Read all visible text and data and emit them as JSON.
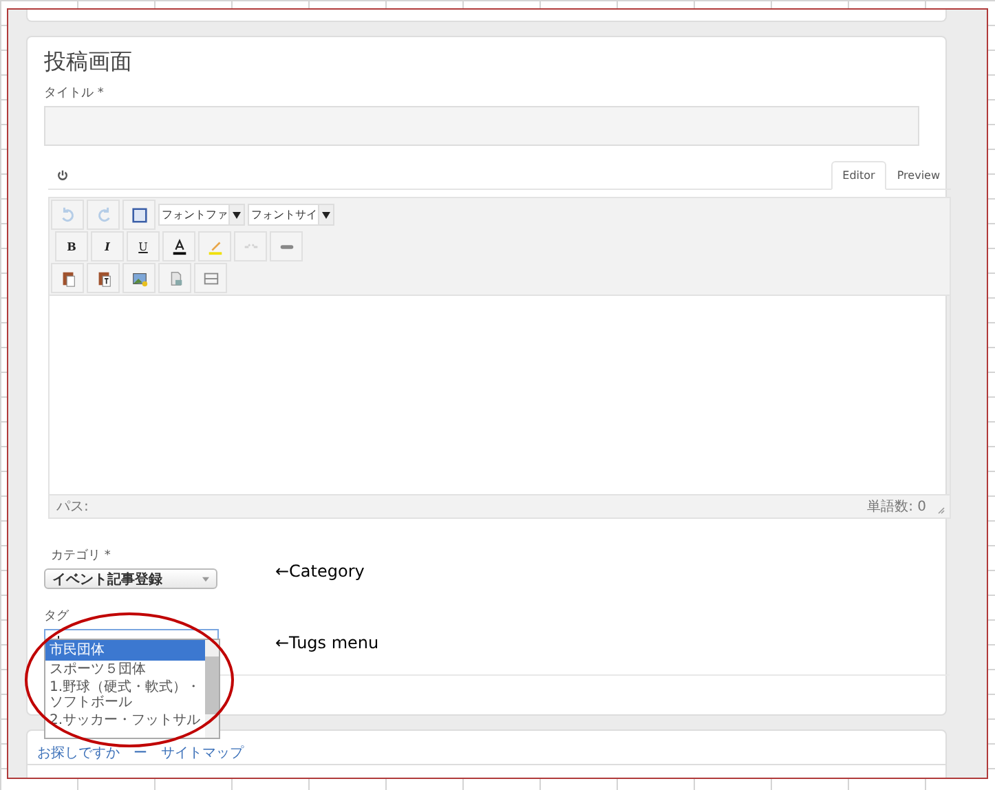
{
  "page_title": "投稿画面",
  "title_field": {
    "label": "タイトル *"
  },
  "editor": {
    "tabs": [
      {
        "label": "Editor",
        "selected": true
      },
      {
        "label": "Preview",
        "selected": false
      }
    ],
    "toolbar_rows": [
      [
        {
          "kind": "undo",
          "disabled": true
        },
        {
          "kind": "redo",
          "disabled": true
        },
        {
          "kind": "fullscreen",
          "disabled": false
        },
        {
          "kind": "select",
          "text": "フォントファ"
        },
        {
          "kind": "select",
          "text": "フォントサイ"
        }
      ],
      [
        {
          "kind": "text",
          "text": "B",
          "disabled": false
        },
        {
          "kind": "text",
          "text": "I",
          "disabled": false
        },
        {
          "kind": "text",
          "text": "U",
          "disabled": false
        },
        {
          "kind": "textcolor",
          "disabled": false
        },
        {
          "kind": "highlight",
          "disabled": false
        },
        {
          "kind": "unlink",
          "disabled": true
        },
        {
          "kind": "link",
          "disabled": false
        }
      ],
      [
        {
          "kind": "paste",
          "disabled": false
        },
        {
          "kind": "pastetext",
          "disabled": false
        },
        {
          "kind": "image",
          "disabled": false
        },
        {
          "kind": "document",
          "disabled": false
        },
        {
          "kind": "rule",
          "disabled": false
        }
      ]
    ],
    "path_label": "パス:",
    "word_count": "単語数: 0"
  },
  "category": {
    "label": "カテゴリ *",
    "value": "イベント記事登録"
  },
  "tags": {
    "label": "タグ",
    "options": [
      {
        "label": "市民団体",
        "selected": true
      },
      {
        "label": "スポーツ５団体",
        "selected": false
      },
      {
        "label": "1.野球（硬式・軟式）・ソフトボール",
        "selected": false
      },
      {
        "label": "2.サッカー・フットサル",
        "selected": false
      }
    ]
  },
  "annotations": [
    "←Category",
    "←Tugs menu"
  ],
  "footer": {
    "links": [
      "お探しですか",
      "サイトマップ"
    ],
    "separator": "ー"
  }
}
